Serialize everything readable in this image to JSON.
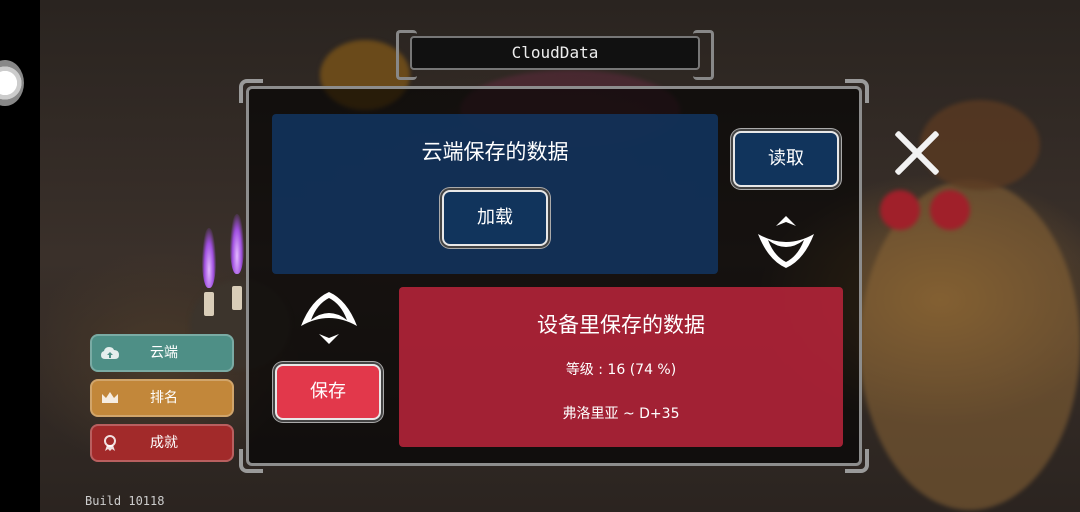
{
  "window": {
    "title": "CloudData"
  },
  "cloud_section": {
    "title": "云端保存的数据",
    "load_label": "加载"
  },
  "read_button": {
    "label": "读取"
  },
  "device_section": {
    "title": "设备里保存的数据",
    "level_text": "等级 : 16 (74 %)",
    "location_text": "弗洛里亚 ~ D+35"
  },
  "save_button": {
    "label": "保存"
  },
  "sidebar": {
    "items": [
      {
        "label": "云端",
        "icon": "cloud-icon",
        "color": "#4e8f86"
      },
      {
        "label": "排名",
        "icon": "crown-icon",
        "color": "#c2873a"
      },
      {
        "label": "成就",
        "icon": "medal-icon",
        "color": "#a22a2a"
      }
    ]
  },
  "build": {
    "text": "Build 10118"
  },
  "colors": {
    "cloud_box": "#12345f",
    "device_box": "#b22438",
    "save_button": "#e2384b",
    "button_dark": "#11345c"
  }
}
